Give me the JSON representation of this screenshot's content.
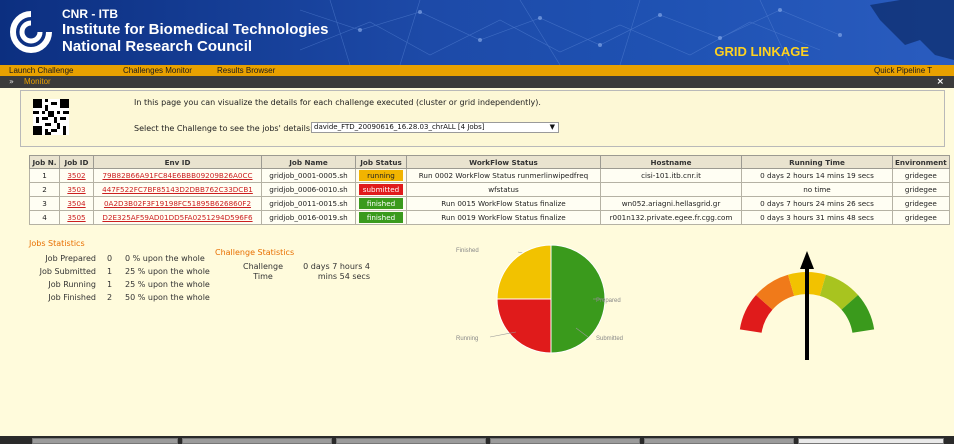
{
  "header": {
    "org_line1": "CNR - ITB",
    "org_line2": "Institute for Biomedical Technologies",
    "org_line3": "National Research Council",
    "app_title": "GRID LINKAGE"
  },
  "menu": {
    "items": [
      "Launch Challenge",
      "Challenges Monitor",
      "Results Browser"
    ],
    "right_item": "Quick Pipeline T"
  },
  "monitor": {
    "title": "Monitor"
  },
  "info": {
    "description": "In this page you can visualize the details for each challenge executed (cluster or grid independently).",
    "select_label": "Select the Challenge to see the jobs' details:",
    "selected_challenge": "davide_FTD_20090616_16.28.03_chrALL [4 Jobs]"
  },
  "table": {
    "headers": [
      "Job N.",
      "Job ID",
      "Env ID",
      "Job Name",
      "Job Status",
      "WorkFlow Status",
      "Hostname",
      "Running Time",
      "Environment"
    ],
    "rows": [
      {
        "n": "1",
        "job_id": "3502",
        "env_id": "79B82B66A91FC84E6BBB09209B26A0CC",
        "job_name": "gridjob_0001-0005.sh",
        "status": "running",
        "workflow": "Run 0002 WorkFlow Status runmerlinwipedfreq",
        "hostname": "cisi-101.itb.cnr.it",
        "time": "0 days 2 hours 14 mins 19 secs",
        "env": "gridegee"
      },
      {
        "n": "2",
        "job_id": "3503",
        "env_id": "447F522FC7BF85143D2DBB762C33DCB1",
        "job_name": "gridjob_0006-0010.sh",
        "status": "submitted",
        "workflow": "wfstatus",
        "hostname": "",
        "time": "no time",
        "env": "gridegee"
      },
      {
        "n": "3",
        "job_id": "3504",
        "env_id": "0A2D3B02F3F19198FC51895B626860F2",
        "job_name": "gridjob_0011-0015.sh",
        "status": "finished",
        "workflow": "Run 0015 WorkFlow Status finalize",
        "hostname": "wn052.ariagni.hellasgrid.gr",
        "time": "0 days 7 hours 24 mins 26 secs",
        "env": "gridegee"
      },
      {
        "n": "4",
        "job_id": "3505",
        "env_id": "D2E325AF59AD01DD5FA0251294D596F6",
        "job_name": "gridjob_0016-0019.sh",
        "status": "finished",
        "workflow": "Run 0019 WorkFlow Status finalize",
        "hostname": "r001n132.private.egee.fr.cgg.com",
        "time": "0 days 3 hours 31 mins 48 secs",
        "env": "gridegee"
      }
    ]
  },
  "jobs_statistics": {
    "title": "Jobs Statistics",
    "rows": [
      {
        "label": "Job Prepared",
        "count": "0",
        "percent": "0 % upon the whole"
      },
      {
        "label": "Job Submitted",
        "count": "1",
        "percent": "25 % upon the whole"
      },
      {
        "label": "Job Running",
        "count": "1",
        "percent": "25 % upon the whole"
      },
      {
        "label": "Job Finished",
        "count": "2",
        "percent": "50 % upon the whole"
      }
    ]
  },
  "challenge_statistics": {
    "title": "Challenge Statistics",
    "time_label": "Challenge Time",
    "time_value": "0 days 7 hours 4 mins 54 secs"
  },
  "chart_data": {
    "type": "pie",
    "title": "",
    "slices": [
      {
        "label": "Finished",
        "value": 50,
        "color": "#3a9a1c"
      },
      {
        "label": "Submitted",
        "value": 25,
        "color": "#e01b1b"
      },
      {
        "label": "Running",
        "value": 25,
        "color": "#f2c200"
      },
      {
        "label": "Prepared",
        "value": 0,
        "color": "#999999"
      }
    ]
  },
  "gauge": {
    "value_fraction": 0.5,
    "colors": [
      "#e01b1b",
      "#f07a1a",
      "#f2c200",
      "#a8c41f",
      "#3a9a1c"
    ]
  },
  "colors": {
    "header_blue": "#1d4aa8",
    "menu_orange": "#e8a100",
    "title_gold": "#ffd21f",
    "link_red": "#cc1f1f",
    "panel_bg": "#fffbdc"
  }
}
